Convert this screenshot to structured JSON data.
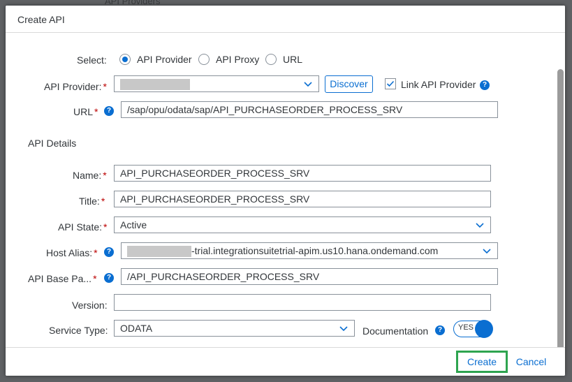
{
  "dialog": {
    "title": "Create API",
    "select_label": "Select:",
    "radios": [
      {
        "label": "API Provider",
        "checked": true
      },
      {
        "label": "API Proxy",
        "checked": false
      },
      {
        "label": "URL",
        "checked": false
      }
    ],
    "api_provider": {
      "label": "API Provider:",
      "value": "",
      "discover_label": "Discover",
      "link_label": "Link API Provider",
      "link_checked": true
    },
    "url": {
      "label": "URL",
      "value": "/sap/opu/odata/sap/API_PURCHASEORDER_PROCESS_SRV"
    },
    "section_title": "API Details",
    "name": {
      "label": "Name:",
      "value": "API_PURCHASEORDER_PROCESS_SRV"
    },
    "title_field": {
      "label": "Title:",
      "value": "API_PURCHASEORDER_PROCESS_SRV"
    },
    "api_state": {
      "label": "API State:",
      "value": "Active"
    },
    "host_alias": {
      "label": "Host Alias:",
      "value": "-trial.integrationsuitetrial-apim.us10.hana.ondemand.com"
    },
    "base_path": {
      "label": "API Base Pa...",
      "value": "/API_PURCHASEORDER_PROCESS_SRV"
    },
    "version": {
      "label": "Version:",
      "value": ""
    },
    "service_type": {
      "label": "Service Type:",
      "value": "ODATA"
    },
    "documentation": {
      "label": "Documentation",
      "switch_label": "YES",
      "on": true
    },
    "footer": {
      "create_label": "Create",
      "cancel_label": "Cancel"
    }
  },
  "background": {
    "top_text": "API Providers"
  },
  "colors": {
    "accent": "#0a6ed1",
    "required": "#bb0000",
    "highlight": "#2ea44f"
  }
}
